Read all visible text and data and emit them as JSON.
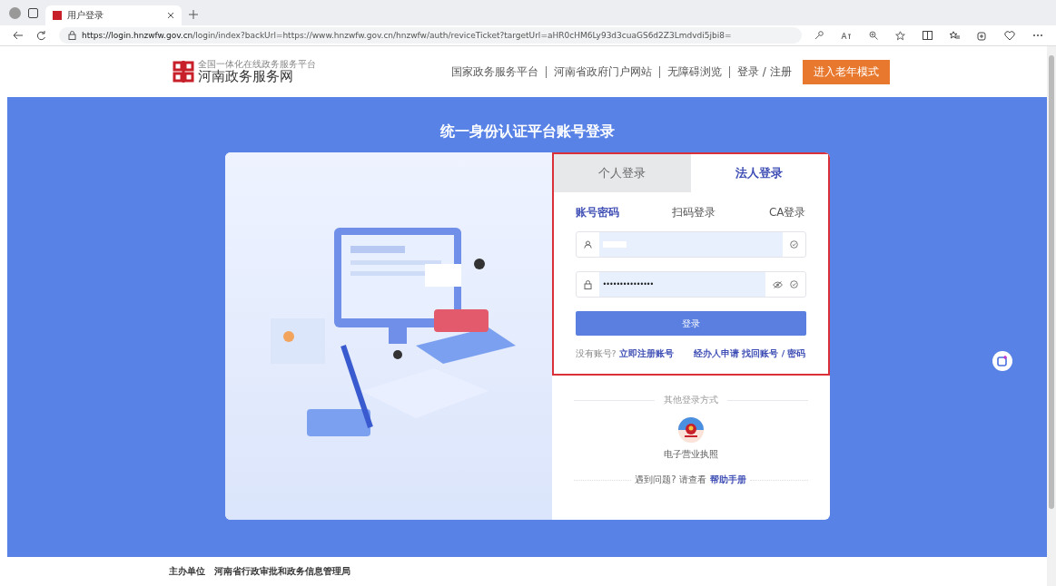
{
  "browser": {
    "tab_title": "用户登录",
    "url_host": "https://login.hnzwfw.gov.cn",
    "url_rest": "/login/index?backUrl=https://www.hnzwfw.gov.cn/hnzwfw/auth/reviceTicket?targetUrl=aHR0cHM6Ly93d3cuaGS6d2Z3Lmdvdi5jbi8="
  },
  "header": {
    "logo_subtitle": "全国一体化在线政务服务平台",
    "logo_title": "河南政务服务网",
    "nav": [
      "国家政务服务平台",
      "河南省政府门户网站",
      "无障碍浏览",
      "登录 / 注册"
    ],
    "elder_button": "进入老年模式"
  },
  "page_title": "统一身份认证平台账号登录",
  "login_tabs": [
    {
      "label": "个人登录",
      "selected": false
    },
    {
      "label": "法人登录",
      "selected": true
    }
  ],
  "method_tabs": [
    {
      "label": "账号密码",
      "selected": true
    },
    {
      "label": "扫码登录",
      "selected": false
    },
    {
      "label": "CA登录",
      "selected": false
    }
  ],
  "password": {
    "value": "•••••••••••••••"
  },
  "login_button": "登录",
  "no_account": "没有账号?",
  "register_link": "立即注册账号",
  "agent_link": "经办人申请",
  "recover_link": "找回账号 / 密码",
  "other_methods": "其他登录方式",
  "license_label": "电子营业执照",
  "help_prefix": "遇到问题? 请查看",
  "help_link": "帮助手册",
  "footer": {
    "label": "主办单位",
    "value": "河南省行政审批和政务信息管理局"
  }
}
